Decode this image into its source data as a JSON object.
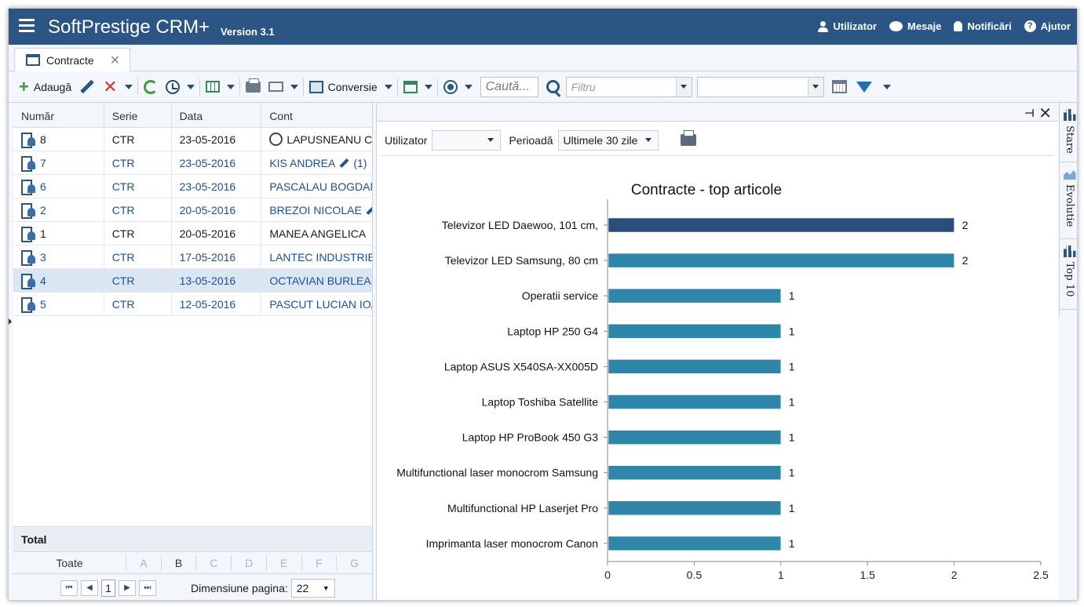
{
  "app": {
    "title": "SoftPrestige CRM+",
    "version": "Version 3.1",
    "nav": {
      "user": "Utilizator",
      "messages": "Mesaje",
      "notifications": "Notificări",
      "help": "Ajutor"
    }
  },
  "tab": {
    "label": "Contracte"
  },
  "toolbar": {
    "add_label": "Adaugă",
    "convert_label": "Conversie",
    "search_placeholder": "Caută...",
    "filter_placeholder": "Filtru"
  },
  "grid": {
    "columns": [
      "Număr",
      "Serie",
      "Data",
      "Cont"
    ],
    "rows": [
      {
        "numar": "8",
        "serie": "CTR",
        "data": "23-05-2016",
        "cont": "LAPUSNEANU C"
      },
      {
        "numar": "7",
        "serie": "CTR",
        "data": "23-05-2016",
        "cont": "KIS ANDREA",
        "extra": "(1)"
      },
      {
        "numar": "6",
        "serie": "CTR",
        "data": "23-05-2016",
        "cont": "PASCALAU BOGDAN"
      },
      {
        "numar": "2",
        "serie": "CTR",
        "data": "20-05-2016",
        "cont": "BREZOI NICOLAE"
      },
      {
        "numar": "1",
        "serie": "CTR",
        "data": "20-05-2016",
        "cont": "MANEA ANGELICA"
      },
      {
        "numar": "3",
        "serie": "CTR",
        "data": "17-05-2016",
        "cont": "LANTEC INDUSTRIES"
      },
      {
        "numar": "4",
        "serie": "CTR",
        "data": "13-05-2016",
        "cont": "OCTAVIAN BURLEA"
      },
      {
        "numar": "5",
        "serie": "CTR",
        "data": "12-05-2016",
        "cont": "PASCUT LUCIAN IOAN"
      }
    ],
    "total_label": "Total",
    "alpha": {
      "all": "Toate",
      "letters": [
        "A",
        "B",
        "C",
        "D",
        "E",
        "F",
        "G"
      ]
    },
    "pager": {
      "page": "1",
      "size_label": "Dimensiune pagina:",
      "size": "22"
    }
  },
  "panel": {
    "user_label": "Utilizator",
    "user_value": "",
    "period_label": "Perioadă",
    "period_value": "Ultimele 30 zile"
  },
  "side_tabs": [
    "Stare",
    "Evolutie",
    "Top 10"
  ],
  "colors": {
    "header": "#2a5585",
    "bar": "#2e86ab",
    "bar_selected": "#2a4e7c"
  },
  "chart_data": {
    "type": "bar",
    "orientation": "horizontal",
    "title": "Contracte - top articole",
    "categories": [
      "Televizor LED Daewoo, 101 cm,",
      "Televizor LED Samsung, 80 cm",
      "Operatii service",
      "Laptop HP 250 G4",
      "Laptop ASUS X540SA-XX005D",
      "Laptop Toshiba Satellite",
      "Laptop HP ProBook 450 G3",
      "Multifunctional laser monocrom Samsung",
      "Multifunctional HP Laserjet Pro",
      "Imprimanta laser monocrom Canon"
    ],
    "values": [
      2,
      2,
      1,
      1,
      1,
      1,
      1,
      1,
      1,
      1
    ],
    "xlim": [
      0,
      2.5
    ],
    "xticks": [
      "0",
      "0.5",
      "1",
      "1.5",
      "2",
      "2.5"
    ],
    "grid": false,
    "highlight_index": 0
  }
}
